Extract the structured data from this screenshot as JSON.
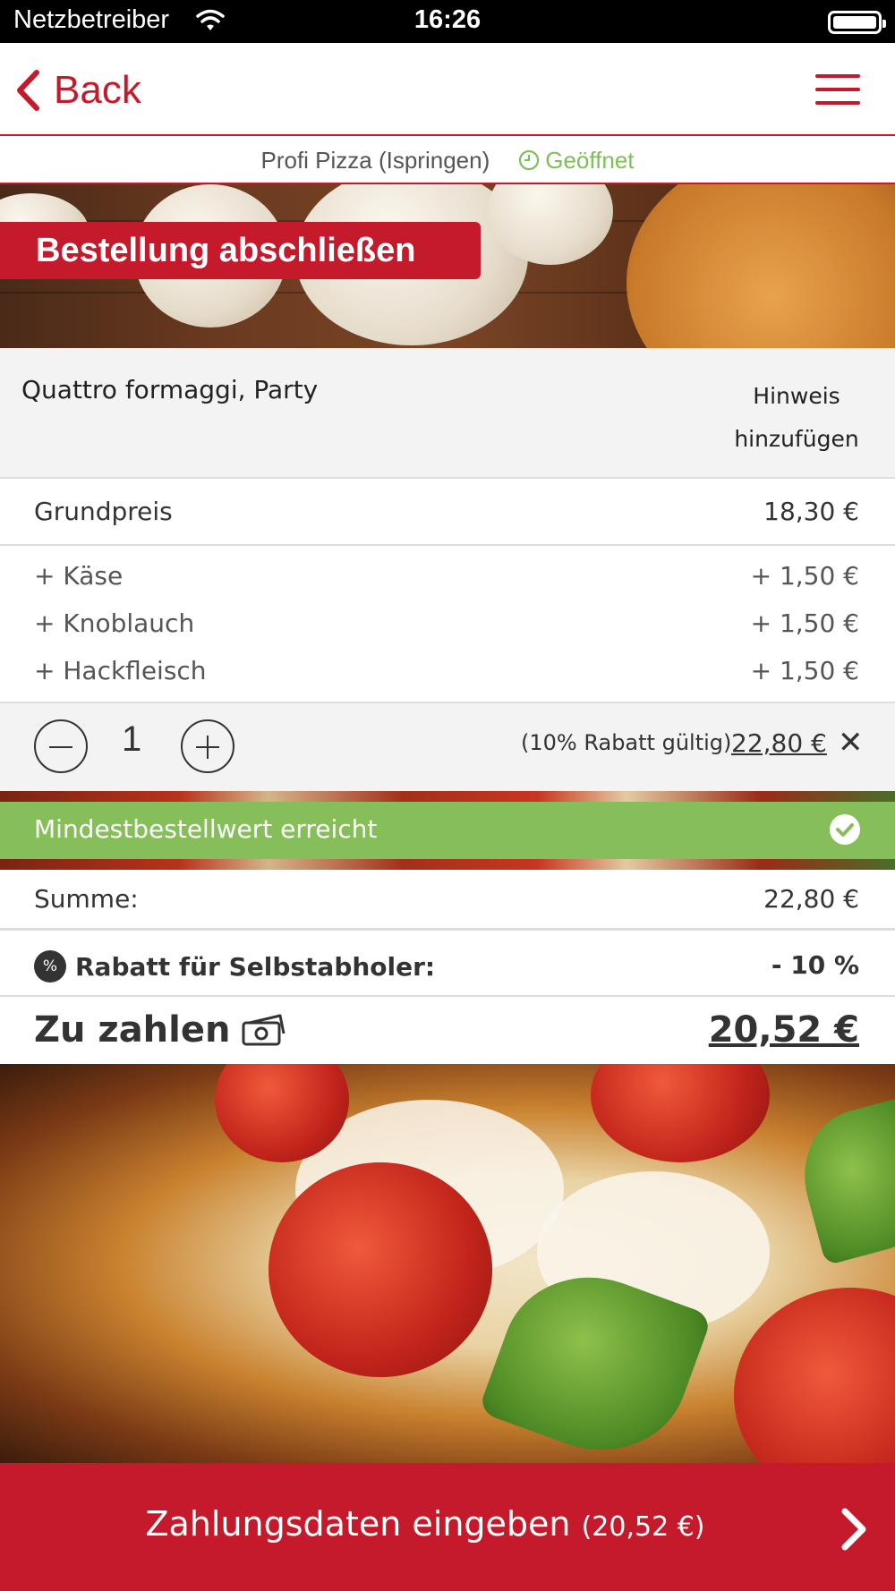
{
  "status_bar": {
    "carrier": "Netzbetreiber",
    "time": "16:26"
  },
  "nav": {
    "back_label": "Back",
    "menu_icon": "hamburger-menu-icon"
  },
  "restaurant": {
    "name": "Profi Pizza (Ispringen)",
    "status": "Geöffnet"
  },
  "hero": {
    "title": "Bestellung abschließen"
  },
  "product": {
    "name": "Quattro formaggi, Party",
    "add_note_label": "Hinweis hinzufügen"
  },
  "base_price": {
    "label": "Grundpreis",
    "value": "18,30 €"
  },
  "extras": [
    {
      "label": "+ Käse",
      "value": "+ 1,50 €"
    },
    {
      "label": "+ Knoblauch",
      "value": "+ 1,50 €"
    },
    {
      "label": "+ Hackfleisch",
      "value": "+ 1,50 €"
    }
  ],
  "quantity": {
    "value": "1",
    "discount_note": "(10% Rabatt gültig)",
    "price": "22,80 €"
  },
  "min_order": {
    "text": "Mindestbestellwert erreicht"
  },
  "summary": {
    "sum_label": "Summe:",
    "sum_value": "22,80 €",
    "discount_label": "Rabatt für Selbstabholer:",
    "discount_value": "- 10 %",
    "discount_badge": "%",
    "to_pay_label": "Zu zahlen",
    "to_pay_value": "20,52 €"
  },
  "cta": {
    "label": "Zahlungsdaten eingeben",
    "amount": "(20,52 €)"
  },
  "colors": {
    "accent": "#c41a2b",
    "success": "#86bf59",
    "open": "#7dc056"
  }
}
